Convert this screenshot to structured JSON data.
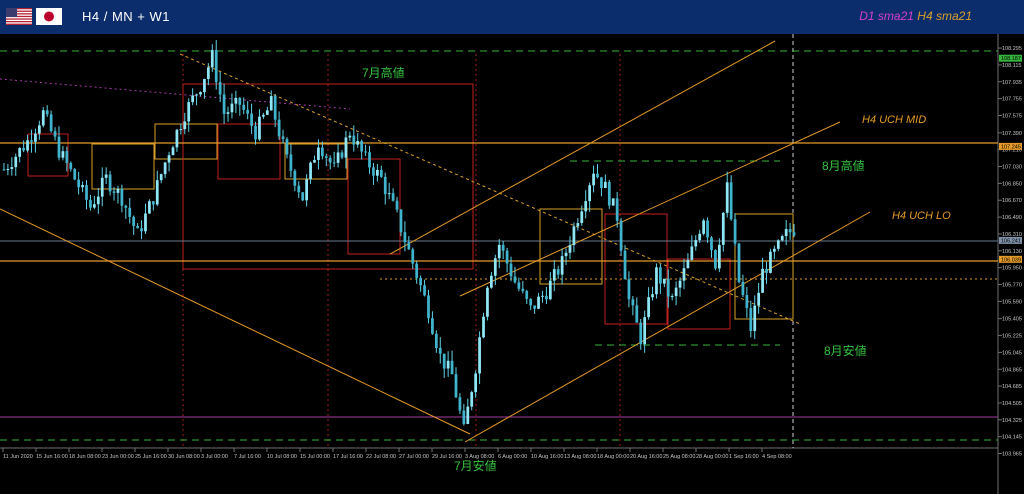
{
  "header": {
    "title": "H4 / MN + W1",
    "legend_d1": "D1 sma21",
    "legend_h4": "H4 sma21",
    "flags": [
      "us-flag-icon",
      "japan-flag-icon"
    ]
  },
  "colors": {
    "background": "#000000",
    "header": "#0b2d6b",
    "candle": "#5fd3e8",
    "channel": "#e39a28",
    "green_dash": "#35b33d",
    "label_green": "#36c23f",
    "label_orange": "#e39a28",
    "d1_sma": "#a43ba4",
    "h4_sma": "#d8a02a",
    "red_box": "#c21f1f"
  },
  "chart_data": {
    "type": "candlestick",
    "symbol_timeframe": "H4",
    "ylim": [
      103.96,
      108.36
    ],
    "price_ticks": [
      "108.295",
      "108.115",
      "107.935",
      "107.755",
      "107.575",
      "107.390",
      "107.210",
      "107.030",
      "106.850",
      "106.670",
      "106.490",
      "106.310",
      "106.130",
      "105.950",
      "105.770",
      "105.590",
      "105.405",
      "105.225",
      "105.045",
      "104.865",
      "104.685",
      "104.505",
      "104.325",
      "104.145",
      "103.965"
    ],
    "price_tags": [
      {
        "value": "108.187",
        "price": 108.187,
        "color": "#35b33d"
      },
      {
        "value": "107.245",
        "price": 107.245,
        "color": "#e39a28"
      },
      {
        "value": "106.241",
        "price": 106.241,
        "color": "#7f8fa8"
      },
      {
        "value": "106.039",
        "price": 106.039,
        "color": "#e39a28"
      }
    ],
    "date_ticks": [
      "11 Jun 2020",
      "15 Jun 16:00",
      "18 Jun 08:00",
      "23 Jun 00:00",
      "25 Jun 16:00",
      "30 Jun 08:00",
      "3 Jul 00:00",
      "7 Jul 16:00",
      "10 Jul 08:00",
      "15 Jul 00:00",
      "17 Jul 16:00",
      "22 Jul 08:00",
      "27 Jul 00:00",
      "29 Jul 16:00",
      "3 Aug 08:00",
      "6 Aug 00:00",
      "10 Aug 16:00",
      "13 Aug 08:00",
      "18 Aug 00:00",
      "20 Aug 16:00",
      "25 Aug 08:00",
      "28 Aug 00:00",
      "1 Sep 16:00",
      "4 Sep 08:00"
    ],
    "series": [
      {
        "price_path": [
          [
            0,
            107.0
          ],
          [
            6,
            107.3
          ],
          [
            10,
            107.6
          ],
          [
            14,
            107.2
          ],
          [
            18,
            106.9
          ],
          [
            22,
            106.6
          ],
          [
            26,
            106.9
          ],
          [
            30,
            106.7
          ],
          [
            34,
            106.3
          ],
          [
            38,
            106.7
          ],
          [
            42,
            107.2
          ],
          [
            46,
            107.6
          ],
          [
            50,
            107.9
          ],
          [
            53,
            108.2
          ],
          [
            56,
            107.6
          ],
          [
            60,
            107.7
          ],
          [
            64,
            107.4
          ],
          [
            68,
            107.7
          ],
          [
            72,
            107.1
          ],
          [
            76,
            106.7
          ],
          [
            80,
            107.3
          ],
          [
            84,
            107.0
          ],
          [
            88,
            107.4
          ],
          [
            92,
            107.1
          ],
          [
            96,
            106.9
          ],
          [
            100,
            106.5
          ],
          [
            104,
            106.0
          ],
          [
            108,
            105.5
          ],
          [
            111,
            105.0
          ],
          [
            114,
            104.8
          ],
          [
            117,
            104.2
          ],
          [
            120,
            104.9
          ],
          [
            123,
            105.8
          ],
          [
            126,
            106.2
          ],
          [
            130,
            105.8
          ],
          [
            134,
            105.5
          ],
          [
            138,
            105.7
          ],
          [
            142,
            106.0
          ],
          [
            146,
            106.5
          ],
          [
            150,
            107.0
          ],
          [
            153,
            106.8
          ],
          [
            156,
            106.5
          ],
          [
            159,
            105.6
          ],
          [
            162,
            105.2
          ],
          [
            166,
            105.9
          ],
          [
            170,
            105.6
          ],
          [
            174,
            106.0
          ],
          [
            178,
            106.5
          ],
          [
            181,
            106.0
          ],
          [
            184,
            106.8
          ],
          [
            187,
            105.8
          ],
          [
            190,
            105.3
          ],
          [
            193,
            105.9
          ],
          [
            196,
            106.1
          ],
          [
            199,
            106.3
          ],
          [
            202,
            106.4
          ]
        ]
      }
    ]
  },
  "annotations": {
    "july_high": "7月高値",
    "aug_high": "8月高値",
    "h4_uch_mid": "H4 UCH MID",
    "h4_uch_lo": "H4 UCH LO",
    "aug_low": "8月安値",
    "july_low": "7月安値"
  }
}
